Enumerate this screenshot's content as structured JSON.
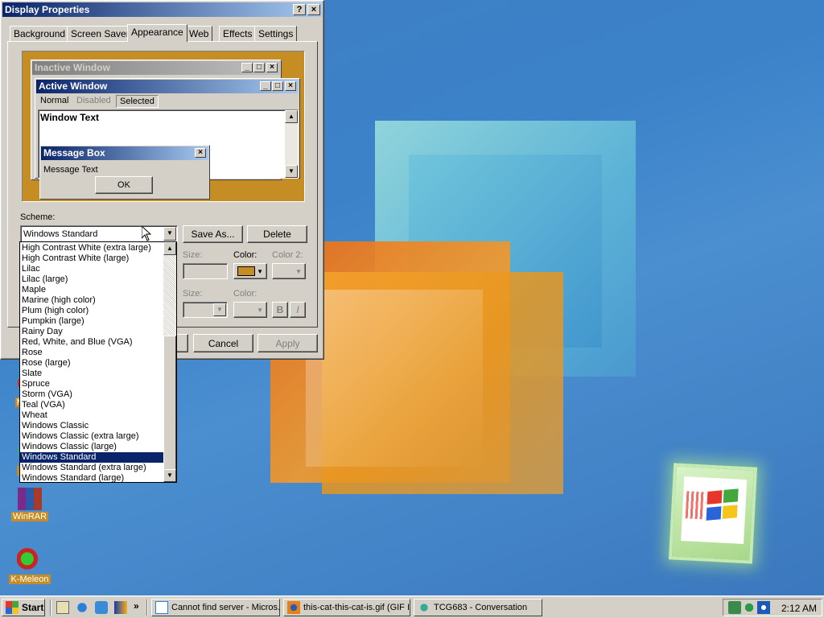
{
  "window": {
    "title": "Display Properties",
    "help": "?",
    "close": "×"
  },
  "tabs": [
    "Background",
    "Screen Saver",
    "Appearance",
    "Web",
    "Effects",
    "Settings"
  ],
  "active_tab": "Appearance",
  "preview": {
    "inactive_title": "Inactive Window",
    "active_title": "Active Window",
    "menu": {
      "normal": "Normal",
      "disabled": "Disabled",
      "selected": "Selected"
    },
    "window_text": "Window Text",
    "msgbox_title": "Message Box",
    "msgbox_text": "Message Text",
    "ok": "OK"
  },
  "scheme": {
    "label": "Scheme:",
    "value": "Windows Standard",
    "save_as": "Save As...",
    "delete": "Delete"
  },
  "item_row": {
    "size": "Size:",
    "color": "Color:",
    "color2": "Color 2:"
  },
  "font_row": {
    "size": "Size:",
    "color": "Color:",
    "bold": "B",
    "italic": "I"
  },
  "buttons": {
    "cancel": "Cancel",
    "apply": "Apply"
  },
  "scheme_list": [
    "High Contrast White (extra large)",
    "High Contrast White (large)",
    "Lilac",
    "Lilac (large)",
    "Maple",
    "Marine (high color)",
    "Plum (high color)",
    "Pumpkin (large)",
    "Rainy Day",
    "Red, White, and Blue (VGA)",
    "Rose",
    "Rose (large)",
    "Slate",
    "Spruce",
    "Storm (VGA)",
    "Teal (VGA)",
    "Wheat",
    "Windows Classic",
    "Windows Classic (extra large)",
    "Windows Classic (large)",
    "Windows Standard",
    "Windows Standard (extra large)",
    "Windows Standard (large)"
  ],
  "selected_scheme": "Windows Standard",
  "desktop_icons": [
    {
      "label": "Moz",
      "icon": "mozilla-icon"
    },
    {
      "label": "Me",
      "icon": "messenger-icon"
    },
    {
      "label": "WinRAR",
      "icon": "winrar-icon"
    },
    {
      "label": "K-Meleon",
      "icon": "kmeleon-icon"
    }
  ],
  "taskbar": {
    "start": "Start",
    "tasks": [
      "Cannot find server - Micros...",
      "this-cat-this-cat-is.gif (GIF I...",
      "TCG683 - Conversation"
    ],
    "quicklaunch_more": "»",
    "clock": "2:12 AM"
  },
  "colors": {
    "desktop": "#3b82c9",
    "window": "#d4d0c8",
    "title_active": "#0a246a",
    "title_inactive": "#808080",
    "preview_bg": "#c68d25",
    "selection": "#0a246a"
  }
}
